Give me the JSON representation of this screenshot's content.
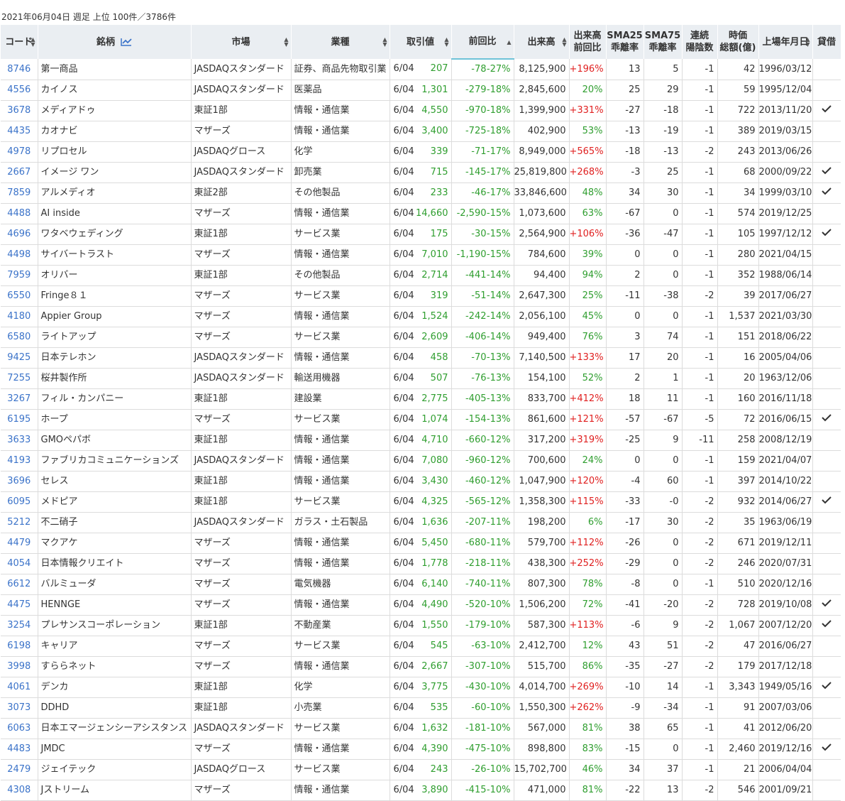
{
  "summary": "2021年06月04日 週足 上位 100件／3786件",
  "headers": {
    "code": "コード",
    "name": "銘柄",
    "market": "市場",
    "sector": "業種",
    "price": "取引値",
    "change": "前回比",
    "volume": "出来高",
    "volume_ratio": [
      "出来高",
      "前回比"
    ],
    "sma25": [
      "SMA25",
      "乖離率"
    ],
    "sma75": [
      "SMA75",
      "乖離率"
    ],
    "streak": [
      "連続",
      "陽陰数"
    ],
    "market_cap": [
      "時価",
      "総額(億)"
    ],
    "listed": "上場年月日",
    "lending": "貸借"
  },
  "icons": {
    "chart": "line-chart-icon",
    "check": "check-icon",
    "sort": "sort-arrows-icon"
  },
  "colors": {
    "header_bg": "#eaeef2",
    "link": "#3b73c9",
    "positive": "#2f9e2f",
    "negative": "#e02020",
    "sort_underline": "#6fc3d8"
  },
  "rows": [
    {
      "code": "8746",
      "name": "第一商品",
      "market": "JASDAQスタンダード",
      "sector": "証券、商品先物取引業",
      "date": "6/04",
      "price": "207",
      "change": "-78",
      "change_pct": "-27%",
      "volume": "8,125,900",
      "vol_ratio": "+196%",
      "vol_up": true,
      "sma25": "13",
      "sma75": "5",
      "streak": "-1",
      "mcap": "42",
      "listed": "1996/03/12",
      "lending": false
    },
    {
      "code": "4556",
      "name": "カイノス",
      "market": "JASDAQスタンダード",
      "sector": "医薬品",
      "date": "6/04",
      "price": "1,301",
      "change": "-279",
      "change_pct": "-18%",
      "volume": "2,845,600",
      "vol_ratio": "20%",
      "vol_up": false,
      "sma25": "25",
      "sma75": "29",
      "streak": "-1",
      "mcap": "59",
      "listed": "1995/12/04",
      "lending": false
    },
    {
      "code": "3678",
      "name": "メディアドゥ",
      "market": "東証1部",
      "sector": "情報・通信業",
      "date": "6/04",
      "price": "4,550",
      "change": "-970",
      "change_pct": "-18%",
      "volume": "1,399,900",
      "vol_ratio": "+331%",
      "vol_up": true,
      "sma25": "-27",
      "sma75": "-18",
      "streak": "-1",
      "mcap": "722",
      "listed": "2013/11/20",
      "lending": true
    },
    {
      "code": "4435",
      "name": "カオナビ",
      "market": "マザーズ",
      "sector": "情報・通信業",
      "date": "6/04",
      "price": "3,400",
      "change": "-725",
      "change_pct": "-18%",
      "volume": "402,900",
      "vol_ratio": "53%",
      "vol_up": false,
      "sma25": "-13",
      "sma75": "-19",
      "streak": "-1",
      "mcap": "389",
      "listed": "2019/03/15",
      "lending": false
    },
    {
      "code": "4978",
      "name": "リプロセル",
      "market": "JASDAQグロース",
      "sector": "化学",
      "date": "6/04",
      "price": "339",
      "change": "-71",
      "change_pct": "-17%",
      "volume": "8,949,000",
      "vol_ratio": "+565%",
      "vol_up": true,
      "sma25": "-18",
      "sma75": "-13",
      "streak": "-2",
      "mcap": "243",
      "listed": "2013/06/26",
      "lending": false
    },
    {
      "code": "2667",
      "name": "イメージ ワン",
      "market": "JASDAQスタンダード",
      "sector": "卸売業",
      "date": "6/04",
      "price": "715",
      "change": "-145",
      "change_pct": "-17%",
      "volume": "25,819,800",
      "vol_ratio": "+268%",
      "vol_up": true,
      "sma25": "-3",
      "sma75": "25",
      "streak": "-1",
      "mcap": "68",
      "listed": "2000/09/22",
      "lending": true
    },
    {
      "code": "7859",
      "name": "アルメディオ",
      "market": "東証2部",
      "sector": "その他製品",
      "date": "6/04",
      "price": "233",
      "change": "-46",
      "change_pct": "-17%",
      "volume": "33,846,600",
      "vol_ratio": "48%",
      "vol_up": false,
      "sma25": "34",
      "sma75": "30",
      "streak": "-1",
      "mcap": "34",
      "listed": "1999/03/10",
      "lending": true
    },
    {
      "code": "4488",
      "name": "AI inside",
      "market": "マザーズ",
      "sector": "情報・通信業",
      "date": "6/04",
      "price": "14,660",
      "change": "-2,590",
      "change_pct": "-15%",
      "volume": "1,073,600",
      "vol_ratio": "63%",
      "vol_up": false,
      "sma25": "-67",
      "sma75": "0",
      "streak": "-1",
      "mcap": "574",
      "listed": "2019/12/25",
      "lending": false
    },
    {
      "code": "4696",
      "name": "ワタベウェディング",
      "market": "東証1部",
      "sector": "サービス業",
      "date": "6/04",
      "price": "175",
      "change": "-30",
      "change_pct": "-15%",
      "volume": "2,564,900",
      "vol_ratio": "+106%",
      "vol_up": true,
      "sma25": "-36",
      "sma75": "-47",
      "streak": "-1",
      "mcap": "105",
      "listed": "1997/12/12",
      "lending": true
    },
    {
      "code": "4498",
      "name": "サイバートラスト",
      "market": "マザーズ",
      "sector": "情報・通信業",
      "date": "6/04",
      "price": "7,010",
      "change": "-1,190",
      "change_pct": "-15%",
      "volume": "784,600",
      "vol_ratio": "39%",
      "vol_up": false,
      "sma25": "0",
      "sma75": "0",
      "streak": "-1",
      "mcap": "280",
      "listed": "2021/04/15",
      "lending": false
    },
    {
      "code": "7959",
      "name": "オリバー",
      "market": "東証1部",
      "sector": "その他製品",
      "date": "6/04",
      "price": "2,714",
      "change": "-441",
      "change_pct": "-14%",
      "volume": "94,400",
      "vol_ratio": "94%",
      "vol_up": false,
      "sma25": "2",
      "sma75": "0",
      "streak": "-1",
      "mcap": "352",
      "listed": "1988/06/14",
      "lending": false
    },
    {
      "code": "6550",
      "name": "Fringe８１",
      "market": "マザーズ",
      "sector": "サービス業",
      "date": "6/04",
      "price": "319",
      "change": "-51",
      "change_pct": "-14%",
      "volume": "2,647,300",
      "vol_ratio": "25%",
      "vol_up": false,
      "sma25": "-11",
      "sma75": "-38",
      "streak": "-2",
      "mcap": "39",
      "listed": "2017/06/27",
      "lending": false
    },
    {
      "code": "4180",
      "name": "Appier Group",
      "market": "マザーズ",
      "sector": "情報・通信業",
      "date": "6/04",
      "price": "1,524",
      "change": "-242",
      "change_pct": "-14%",
      "volume": "2,056,100",
      "vol_ratio": "45%",
      "vol_up": false,
      "sma25": "0",
      "sma75": "0",
      "streak": "-1",
      "mcap": "1,537",
      "listed": "2021/03/30",
      "lending": false
    },
    {
      "code": "6580",
      "name": "ライトアップ",
      "market": "マザーズ",
      "sector": "サービス業",
      "date": "6/04",
      "price": "2,609",
      "change": "-406",
      "change_pct": "-14%",
      "volume": "949,400",
      "vol_ratio": "76%",
      "vol_up": false,
      "sma25": "3",
      "sma75": "74",
      "streak": "-1",
      "mcap": "151",
      "listed": "2018/06/22",
      "lending": false
    },
    {
      "code": "9425",
      "name": "日本テレホン",
      "market": "JASDAQスタンダード",
      "sector": "情報・通信業",
      "date": "6/04",
      "price": "458",
      "change": "-70",
      "change_pct": "-13%",
      "volume": "7,140,500",
      "vol_ratio": "+133%",
      "vol_up": true,
      "sma25": "17",
      "sma75": "20",
      "streak": "-1",
      "mcap": "16",
      "listed": "2005/04/06",
      "lending": false
    },
    {
      "code": "7255",
      "name": "桜井製作所",
      "market": "JASDAQスタンダード",
      "sector": "輸送用機器",
      "date": "6/04",
      "price": "507",
      "change": "-76",
      "change_pct": "-13%",
      "volume": "154,100",
      "vol_ratio": "52%",
      "vol_up": false,
      "sma25": "2",
      "sma75": "1",
      "streak": "-1",
      "mcap": "20",
      "listed": "1963/12/06",
      "lending": false
    },
    {
      "code": "3267",
      "name": "フィル・カンパニー",
      "market": "東証1部",
      "sector": "建設業",
      "date": "6/04",
      "price": "2,775",
      "change": "-405",
      "change_pct": "-13%",
      "volume": "833,700",
      "vol_ratio": "+412%",
      "vol_up": true,
      "sma25": "18",
      "sma75": "11",
      "streak": "-1",
      "mcap": "160",
      "listed": "2016/11/18",
      "lending": false
    },
    {
      "code": "6195",
      "name": "ホープ",
      "market": "マザーズ",
      "sector": "サービス業",
      "date": "6/04",
      "price": "1,074",
      "change": "-154",
      "change_pct": "-13%",
      "volume": "861,600",
      "vol_ratio": "+121%",
      "vol_up": true,
      "sma25": "-57",
      "sma75": "-67",
      "streak": "-5",
      "mcap": "72",
      "listed": "2016/06/15",
      "lending": true
    },
    {
      "code": "3633",
      "name": "GMOペパボ",
      "market": "東証1部",
      "sector": "情報・通信業",
      "date": "6/04",
      "price": "4,710",
      "change": "-660",
      "change_pct": "-12%",
      "volume": "317,200",
      "vol_ratio": "+319%",
      "vol_up": true,
      "sma25": "-25",
      "sma75": "9",
      "streak": "-11",
      "mcap": "258",
      "listed": "2008/12/19",
      "lending": false
    },
    {
      "code": "4193",
      "name": "ファブリカコミュニケーションズ",
      "market": "JASDAQスタンダード",
      "sector": "情報・通信業",
      "date": "6/04",
      "price": "7,080",
      "change": "-960",
      "change_pct": "-12%",
      "volume": "700,600",
      "vol_ratio": "24%",
      "vol_up": false,
      "sma25": "0",
      "sma75": "0",
      "streak": "-1",
      "mcap": "159",
      "listed": "2021/04/07",
      "lending": false
    },
    {
      "code": "3696",
      "name": "セレス",
      "market": "東証1部",
      "sector": "情報・通信業",
      "date": "6/04",
      "price": "3,430",
      "change": "-460",
      "change_pct": "-12%",
      "volume": "1,047,900",
      "vol_ratio": "+120%",
      "vol_up": true,
      "sma25": "-4",
      "sma75": "60",
      "streak": "-1",
      "mcap": "397",
      "listed": "2014/10/22",
      "lending": false
    },
    {
      "code": "6095",
      "name": "メドピア",
      "market": "東証1部",
      "sector": "サービス業",
      "date": "6/04",
      "price": "4,325",
      "change": "-565",
      "change_pct": "-12%",
      "volume": "1,358,300",
      "vol_ratio": "+115%",
      "vol_up": true,
      "sma25": "-33",
      "sma75": "-0",
      "streak": "-2",
      "mcap": "932",
      "listed": "2014/06/27",
      "lending": true
    },
    {
      "code": "5212",
      "name": "不二硝子",
      "market": "JASDAQスタンダード",
      "sector": "ガラス・土石製品",
      "date": "6/04",
      "price": "1,636",
      "change": "-207",
      "change_pct": "-11%",
      "volume": "198,200",
      "vol_ratio": "6%",
      "vol_up": false,
      "sma25": "-17",
      "sma75": "30",
      "streak": "-2",
      "mcap": "35",
      "listed": "1963/06/19",
      "lending": false
    },
    {
      "code": "4479",
      "name": "マクアケ",
      "market": "マザーズ",
      "sector": "情報・通信業",
      "date": "6/04",
      "price": "5,450",
      "change": "-680",
      "change_pct": "-11%",
      "volume": "579,700",
      "vol_ratio": "+112%",
      "vol_up": true,
      "sma25": "-26",
      "sma75": "0",
      "streak": "-2",
      "mcap": "671",
      "listed": "2019/12/11",
      "lending": false
    },
    {
      "code": "4054",
      "name": "日本情報クリエイト",
      "market": "マザーズ",
      "sector": "情報・通信業",
      "date": "6/04",
      "price": "1,778",
      "change": "-218",
      "change_pct": "-11%",
      "volume": "438,300",
      "vol_ratio": "+252%",
      "vol_up": true,
      "sma25": "-29",
      "sma75": "0",
      "streak": "-2",
      "mcap": "246",
      "listed": "2020/07/31",
      "lending": false
    },
    {
      "code": "6612",
      "name": "バルミューダ",
      "market": "マザーズ",
      "sector": "電気機器",
      "date": "6/04",
      "price": "6,140",
      "change": "-740",
      "change_pct": "-11%",
      "volume": "807,300",
      "vol_ratio": "78%",
      "vol_up": false,
      "sma25": "-8",
      "sma75": "0",
      "streak": "-1",
      "mcap": "510",
      "listed": "2020/12/16",
      "lending": false
    },
    {
      "code": "4475",
      "name": "HENNGE",
      "market": "マザーズ",
      "sector": "情報・通信業",
      "date": "6/04",
      "price": "4,490",
      "change": "-520",
      "change_pct": "-10%",
      "volume": "1,506,200",
      "vol_ratio": "72%",
      "vol_up": false,
      "sma25": "-41",
      "sma75": "-20",
      "streak": "-2",
      "mcap": "728",
      "listed": "2019/10/08",
      "lending": true
    },
    {
      "code": "3254",
      "name": "プレサンスコーポレーション",
      "market": "東証1部",
      "sector": "不動産業",
      "date": "6/04",
      "price": "1,550",
      "change": "-179",
      "change_pct": "-10%",
      "volume": "587,300",
      "vol_ratio": "+113%",
      "vol_up": true,
      "sma25": "-6",
      "sma75": "9",
      "streak": "-2",
      "mcap": "1,067",
      "listed": "2007/12/20",
      "lending": true
    },
    {
      "code": "6198",
      "name": "キャリア",
      "market": "マザーズ",
      "sector": "サービス業",
      "date": "6/04",
      "price": "545",
      "change": "-63",
      "change_pct": "-10%",
      "volume": "2,412,700",
      "vol_ratio": "12%",
      "vol_up": false,
      "sma25": "43",
      "sma75": "51",
      "streak": "-2",
      "mcap": "47",
      "listed": "2016/06/27",
      "lending": false
    },
    {
      "code": "3998",
      "name": "すららネット",
      "market": "マザーズ",
      "sector": "情報・通信業",
      "date": "6/04",
      "price": "2,667",
      "change": "-307",
      "change_pct": "-10%",
      "volume": "515,700",
      "vol_ratio": "86%",
      "vol_up": false,
      "sma25": "-35",
      "sma75": "-27",
      "streak": "-2",
      "mcap": "179",
      "listed": "2017/12/18",
      "lending": false
    },
    {
      "code": "4061",
      "name": "デンカ",
      "market": "東証1部",
      "sector": "化学",
      "date": "6/04",
      "price": "3,775",
      "change": "-430",
      "change_pct": "-10%",
      "volume": "4,014,700",
      "vol_ratio": "+269%",
      "vol_up": true,
      "sma25": "-10",
      "sma75": "14",
      "streak": "-1",
      "mcap": "3,343",
      "listed": "1949/05/16",
      "lending": true
    },
    {
      "code": "3073",
      "name": "DDHD",
      "market": "東証1部",
      "sector": "小売業",
      "date": "6/04",
      "price": "535",
      "change": "-60",
      "change_pct": "-10%",
      "volume": "1,550,300",
      "vol_ratio": "+262%",
      "vol_up": true,
      "sma25": "-9",
      "sma75": "-34",
      "streak": "-1",
      "mcap": "91",
      "listed": "2007/03/06",
      "lending": false
    },
    {
      "code": "6063",
      "name": "日本エマージェンシーアシスタンス",
      "market": "JASDAQスタンダード",
      "sector": "サービス業",
      "date": "6/04",
      "price": "1,632",
      "change": "-181",
      "change_pct": "-10%",
      "volume": "567,000",
      "vol_ratio": "81%",
      "vol_up": false,
      "sma25": "38",
      "sma75": "65",
      "streak": "-1",
      "mcap": "41",
      "listed": "2012/06/20",
      "lending": false
    },
    {
      "code": "4483",
      "name": "JMDC",
      "market": "マザーズ",
      "sector": "情報・通信業",
      "date": "6/04",
      "price": "4,390",
      "change": "-475",
      "change_pct": "-10%",
      "volume": "898,800",
      "vol_ratio": "83%",
      "vol_up": false,
      "sma25": "-15",
      "sma75": "0",
      "streak": "-1",
      "mcap": "2,460",
      "listed": "2019/12/16",
      "lending": true
    },
    {
      "code": "2479",
      "name": "ジェイテック",
      "market": "JASDAQグロース",
      "sector": "サービス業",
      "date": "6/04",
      "price": "243",
      "change": "-26",
      "change_pct": "-10%",
      "volume": "15,702,700",
      "vol_ratio": "46%",
      "vol_up": false,
      "sma25": "34",
      "sma75": "37",
      "streak": "-1",
      "mcap": "21",
      "listed": "2006/04/04",
      "lending": false
    },
    {
      "code": "4308",
      "name": "Jストリーム",
      "market": "マザーズ",
      "sector": "情報・通信業",
      "date": "6/04",
      "price": "3,890",
      "change": "-415",
      "change_pct": "-10%",
      "volume": "471,000",
      "vol_ratio": "81%",
      "vol_up": false,
      "sma25": "-22",
      "sma75": "13",
      "streak": "-2",
      "mcap": "546",
      "listed": "2001/09/21",
      "lending": false
    }
  ]
}
